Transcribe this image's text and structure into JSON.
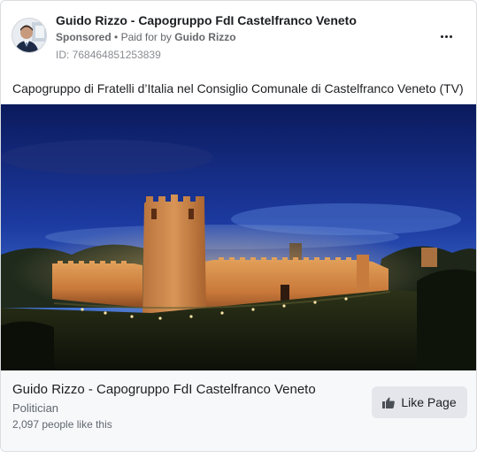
{
  "post": {
    "page_name": "Guido Rizzo - Capogruppo FdI Castelfranco Veneto",
    "sponsored_label": "Sponsored",
    "paid_for_by_prefix": "Paid for by",
    "payer": "Guido Rizzo",
    "separator": "•",
    "ad_id": "ID: 768464851253839",
    "menu_icon": "more-horizontal-icon",
    "body_text": "Capogruppo di Fratelli d’Italia nel Consiglio Comunale di Castelfranco Veneto (TV)"
  },
  "footer": {
    "title": "Guido Rizzo - Capogruppo FdI Castelfranco Veneto",
    "category": "Politician",
    "likes": "2,097 people like this",
    "like_button_label": "Like Page",
    "like_icon": "thumbs-up-icon"
  },
  "colors": {
    "border": "#dadde1",
    "footer_bg": "#f7f8fa",
    "button_bg": "#e4e6eb",
    "secondary_text": "#65676b",
    "primary_text": "#1c1e21"
  }
}
